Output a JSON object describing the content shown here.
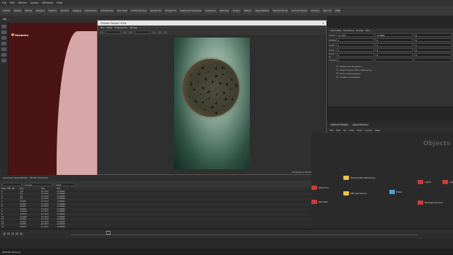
{
  "menubar": [
    "File",
    "Edit",
    "Render",
    "Assets",
    "Windows",
    "Help"
  ],
  "shelf_tabs": [
    "Create",
    "Modify",
    "Model",
    "Polygon",
    "Deform",
    "Texture",
    "Rigging",
    "Characters",
    "Constraints",
    "Hair Utils",
    "Guide Process",
    "Terrain FX",
    "Simple FX",
    "Lights and Cameras",
    "Collisions",
    "Particles",
    "Grains",
    "Vellum",
    "Rigid Bodies",
    "Particle Fluids",
    "Viscous Fluids",
    "Oceans",
    "Pyro FX",
    "FEM"
  ],
  "path": {
    "network": "obj",
    "node": "Geometry"
  },
  "viewport": {
    "label": "Geometry",
    "accent": "#4a1414",
    "shape_color": "#d7a6a6"
  },
  "render_window": {
    "title": "Houdini Render View",
    "menu": [
      "File",
      "View",
      "Preferences",
      "Render"
    ],
    "camera": "/obj/cam1",
    "status": "Progressive Rendering",
    "progress": 0.05
  },
  "parameters": {
    "header": [
      "Geometry",
      "Transform",
      "Render",
      "Misc"
    ],
    "rows": [
      {
        "label": "Trans",
        "values": [
          "-0.1743",
          "-0.9864",
          "0"
        ]
      },
      {
        "label": "Rotate",
        "values": [
          "0",
          "0",
          "0"
        ]
      },
      {
        "label": "Scale",
        "values": [
          "1",
          "1",
          "1"
        ]
      },
      {
        "label": "Pivot",
        "values": [
          "0",
          "0",
          "0"
        ]
      },
      {
        "label": "Pivot R",
        "values": [
          "0",
          "0",
          "0"
        ]
      },
      {
        "label": "Uniform",
        "values": [
          "1",
          "",
          ""
        ]
      }
    ],
    "checks": [
      "Modify Pre-Transform",
      "Keep Position When Parenting",
      "Child Compensation",
      "Enable Constraints"
    ]
  },
  "network": {
    "tabs": [
      "Material Palette",
      "Asset Browser"
    ],
    "menu": [
      "File",
      "Edit",
      "Go",
      "View",
      "Tools",
      "Layout",
      "Help"
    ],
    "title": "Objects",
    "nodes": [
      {
        "name": "Texture_Ball_Rendering",
        "color": "#e9c14a"
      },
      {
        "name": "ENT_Rendering",
        "color": "#e9c14a"
      },
      {
        "name": "Mixer",
        "color": "#4aa3d8"
      },
      {
        "name": "Light1",
        "color": "#d13a3a"
      },
      {
        "name": "Light2",
        "color": "#d13a3a"
      },
      {
        "name": "EnvLight_Environ",
        "color": "#d13a3a"
      },
      {
        "name": "RS2_Floor",
        "color": "#d13a3a"
      },
      {
        "name": "RS2_Ball",
        "color": "#d13a3a"
      }
    ]
  },
  "spreadsheet": {
    "tabs": [
      "Geometry Spreadsheet",
      "Render Scheduler"
    ],
    "filter_label": "Group",
    "view_label": "View",
    "columns": [
      "Node: ENT_RS",
      "P[x]",
      "P[y]",
      "P[z]"
    ],
    "rows": [
      [
        "0",
        "-0.0",
        "14.7437",
        "-0.18999"
      ],
      [
        "1",
        "0.0",
        "14.7437",
        "-0.18999"
      ],
      [
        "2",
        "0.0",
        "14.7437",
        "-0.18999"
      ],
      [
        "3",
        "0.0",
        "14.7437",
        "-0.18999"
      ],
      [
        "4",
        "0.0057",
        "14.7437",
        "-0.18999"
      ],
      [
        "5",
        "0.0057",
        "14.7437",
        "-0.18999"
      ],
      [
        "6",
        "0.0057",
        "14.7437",
        "-0.18999"
      ],
      [
        "7",
        "0.0043",
        "14.7437",
        "-0.18999"
      ],
      [
        "8",
        "-0.0043",
        "14.7437",
        "-0.18999"
      ],
      [
        "9",
        "-0.0071",
        "14.7437",
        "-0.18999"
      ],
      [
        "10",
        "-0.0043",
        "14.7437",
        "-0.18999"
      ],
      [
        "11",
        "0.0021",
        "14.7437",
        "-0.18999"
      ],
      [
        "12",
        "0.0043",
        "14.7437",
        "-0.18999"
      ],
      [
        "13",
        "0.0057",
        "14.7437",
        "-0.18999"
      ],
      [
        "14",
        "0.0057",
        "14.7437",
        "-0.18999"
      ]
    ]
  },
  "timeline": {
    "frame": "1",
    "start": "1",
    "end": "240"
  },
  "status": "RENDER Working"
}
